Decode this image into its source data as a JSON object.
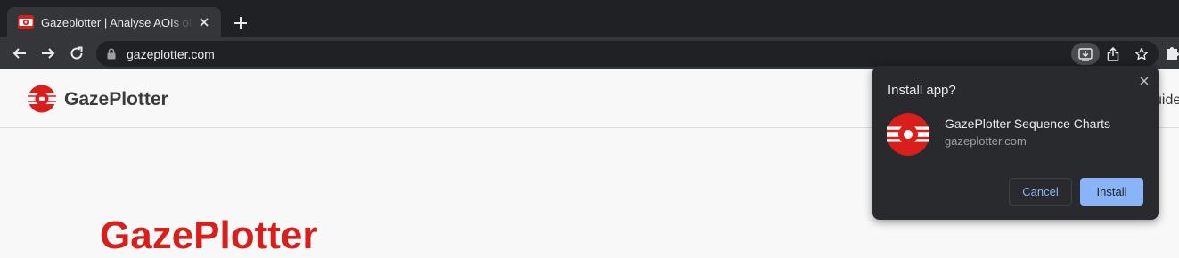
{
  "browser": {
    "tab": {
      "title": "Gazeplotter | Analyse AOIs of eye-tracking data",
      "favicon": "gazeplotter-favicon-icon"
    },
    "new_tab_icon": "plus-icon",
    "nav": {
      "back_icon": "arrow-left-icon",
      "forward_icon": "arrow-right-icon",
      "reload_icon": "reload-icon"
    },
    "address": {
      "url": "gazeplotter.com",
      "lock_icon": "lock-icon"
    },
    "omnibox_actions": [
      "install-app-icon",
      "share-icon",
      "bookmark-star-icon"
    ],
    "extensions_icon": "puzzle-icon"
  },
  "site": {
    "brand_name": "GazePlotter",
    "nav_peek": "uide",
    "hero_title": "GazePlotter",
    "accent_color": "#d81f1c"
  },
  "install_popup": {
    "title": "Install app?",
    "app_name": "GazePlotter Sequence Charts",
    "app_origin": "gazeplotter.com",
    "cancel_label": "Cancel",
    "install_label": "Install",
    "primary_color": "#8ab4f8"
  }
}
